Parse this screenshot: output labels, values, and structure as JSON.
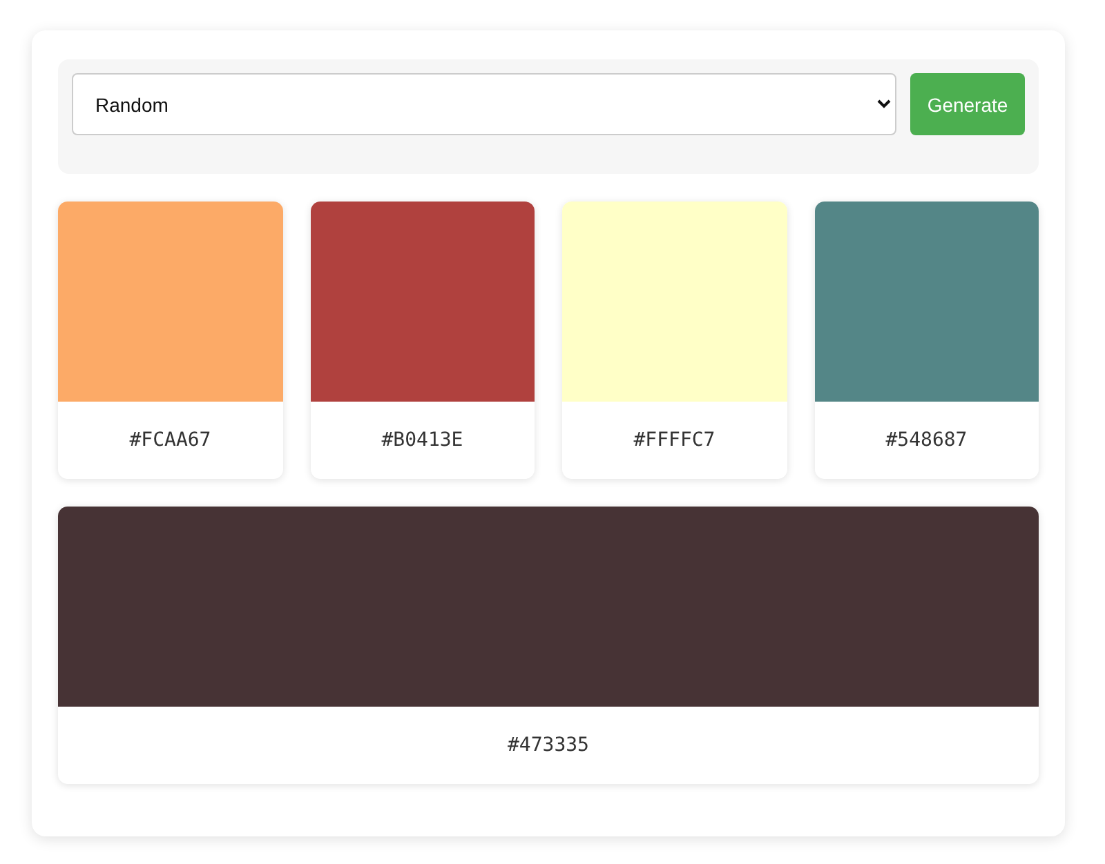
{
  "controls": {
    "mode_select": {
      "value": "Random"
    },
    "generate_button": "Generate"
  },
  "swatches": [
    {
      "hex": "#FCAA67",
      "color": "#fcaa67"
    },
    {
      "hex": "#B0413E",
      "color": "#b0413e"
    },
    {
      "hex": "#FFFFC7",
      "color": "#ffffc7"
    },
    {
      "hex": "#548687",
      "color": "#548687"
    },
    {
      "hex": "#473335",
      "color": "#473335"
    }
  ]
}
